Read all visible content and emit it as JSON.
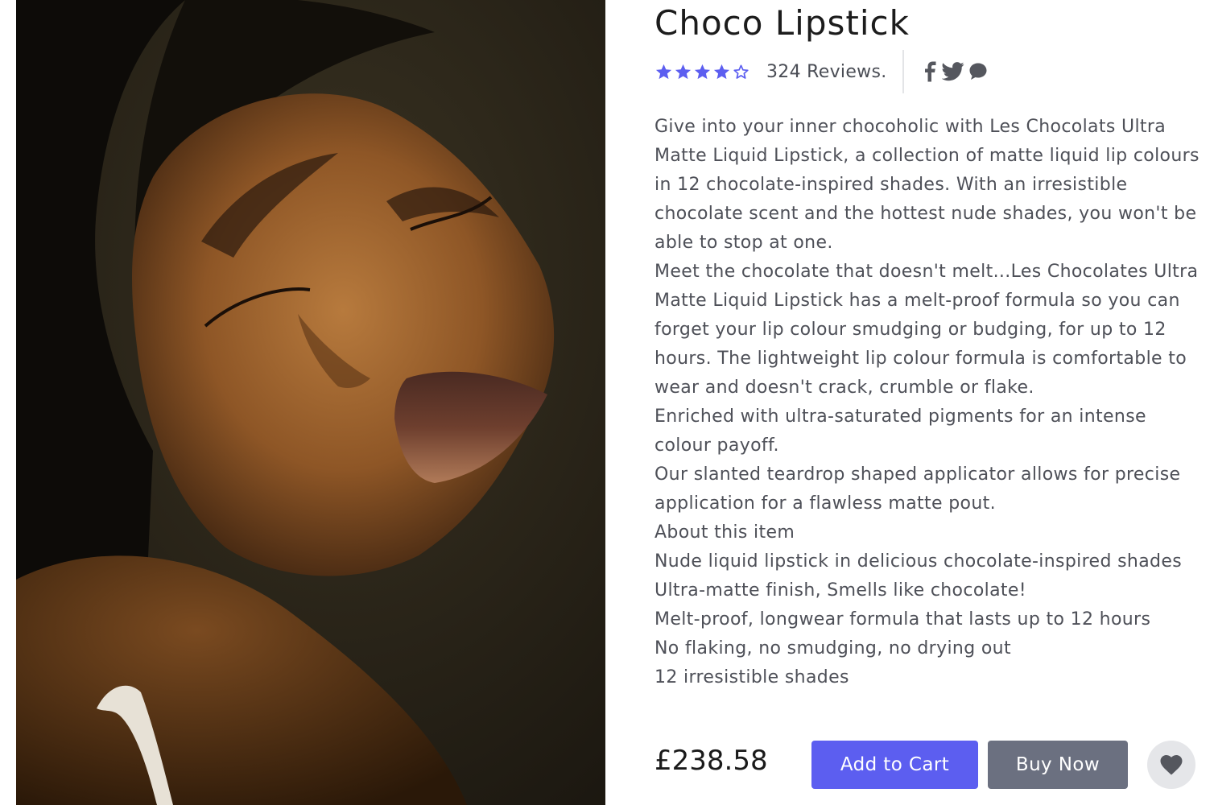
{
  "product": {
    "image_alt": "Model wearing Choco Lipstick",
    "title": "Choco Lipstick",
    "rating": 4,
    "rating_max": 5,
    "reviews_label": "324 Reviews.",
    "description": [
      "Give into your inner chocoholic with Les Chocolats Ultra Matte Liquid Lipstick, a collection of matte liquid lip colours in 12 chocolate-inspired shades. With an irresistible chocolate scent and the hottest nude shades, you won't be able to stop at one.",
      "Meet the chocolate that doesn't melt...Les Chocolates Ultra Matte Liquid Lipstick has a melt-proof formula so you can forget your lip colour smudging or budging, for up to 12 hours. The lightweight lip colour formula is comfortable to wear and doesn't crack, crumble or flake.",
      "Enriched with ultra-saturated pigments for an intense colour payoff.",
      "Our slanted teardrop shaped applicator allows for precise application for a flawless matte pout.",
      "About this item",
      "Nude liquid lipstick in delicious chocolate-inspired shades",
      "Ultra-matte finish, Smells like chocolate!",
      "Melt-proof, longwear formula that lasts up to 12 hours",
      "No flaking, no smudging, no drying out",
      "12 irresistible shades"
    ],
    "price": "£238.58"
  },
  "actions": {
    "add_to_cart": "Add to Cart",
    "buy_now": "Buy Now"
  },
  "share": {
    "icons": [
      "facebook-icon",
      "twitter-icon",
      "chat-icon"
    ]
  },
  "colors": {
    "accent": "#5c5ef0",
    "secondary_button": "#6b7080",
    "star": "#5c5ef0",
    "text": "#4e5058",
    "title": "#1c1c1c",
    "wishlist_bg": "#e5e6e9",
    "wishlist_icon": "#55575e"
  }
}
